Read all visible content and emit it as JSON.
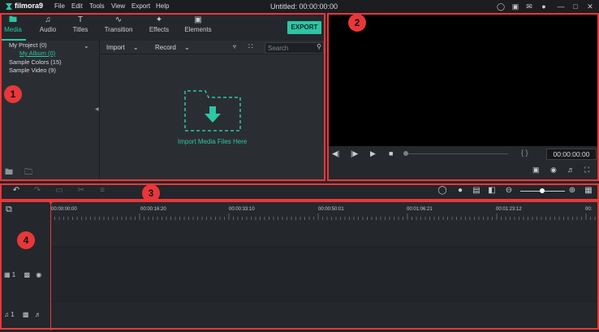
{
  "app": {
    "name": "filmora9",
    "window_title": "Untitled:  00:00:00:00"
  },
  "menu": [
    "File",
    "Edit",
    "Tools",
    "View",
    "Export",
    "Help"
  ],
  "titlebar_icons": [
    "user-icon",
    "save-icon",
    "mail-icon",
    "microphone-icon",
    "minimize-icon",
    "maximize-icon",
    "close-icon"
  ],
  "tabs": [
    {
      "label": "Media",
      "icon": "folder-icon"
    },
    {
      "label": "Audio",
      "icon": "music-note-icon"
    },
    {
      "label": "Titles",
      "icon": "text-icon"
    },
    {
      "label": "Transition",
      "icon": "transition-icon"
    },
    {
      "label": "Effects",
      "icon": "sparkle-icon"
    },
    {
      "label": "Elements",
      "icon": "image-icon"
    }
  ],
  "export_label": "EXPORT",
  "library": {
    "items": [
      {
        "label": "My Project (0)"
      },
      {
        "label": "My Album (0)"
      },
      {
        "label": "Sample Colors (15)"
      },
      {
        "label": "Sample Video (9)"
      }
    ]
  },
  "media_toolbar": {
    "import_label": "Import",
    "record_label": "Record",
    "search_placeholder": "Search"
  },
  "drop_zone": {
    "text": "Import Media Files Here"
  },
  "preview": {
    "timecode": "00:00:00:00",
    "brackets": "{ }"
  },
  "ruler": {
    "labels": [
      "00:00:00:00",
      "00:00:16:20",
      "00:00:33:10",
      "00:00:50:01",
      "00:01:06:21",
      "00:01:23:12",
      "00:"
    ]
  },
  "tracks": {
    "video_track_number": "1",
    "audio_track_number": "1"
  },
  "annotations": [
    "1",
    "2",
    "3",
    "4"
  ],
  "colors": {
    "accent": "#2ec6a4",
    "annotation": "#e8373a",
    "playhead": "#e13c3c"
  }
}
